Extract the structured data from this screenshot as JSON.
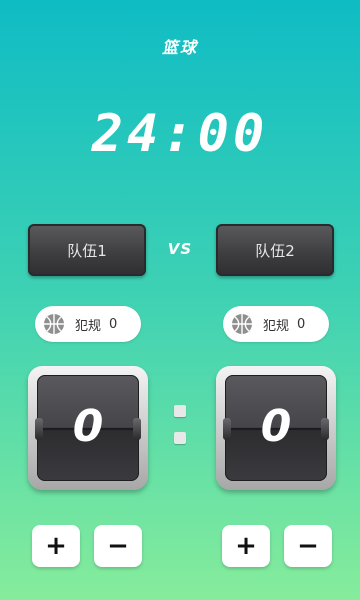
{
  "header": {
    "title": "篮球"
  },
  "timer": {
    "value": "24:00"
  },
  "teams": {
    "left": {
      "name": "队伍1",
      "foul_label": "犯规",
      "foul_count": "0",
      "score": "0"
    },
    "right": {
      "name": "队伍2",
      "foul_label": "犯规",
      "foul_count": "0",
      "score": "0"
    },
    "vs_label": "VS"
  },
  "controls": {
    "plus_label": "+",
    "minus_label": "−"
  },
  "colors": {
    "gradient_top": "#0fbcc4",
    "gradient_bottom": "#86ec9b",
    "panel_dark": "#3f3f42"
  },
  "icons": {
    "foul": "basketball-icon"
  }
}
